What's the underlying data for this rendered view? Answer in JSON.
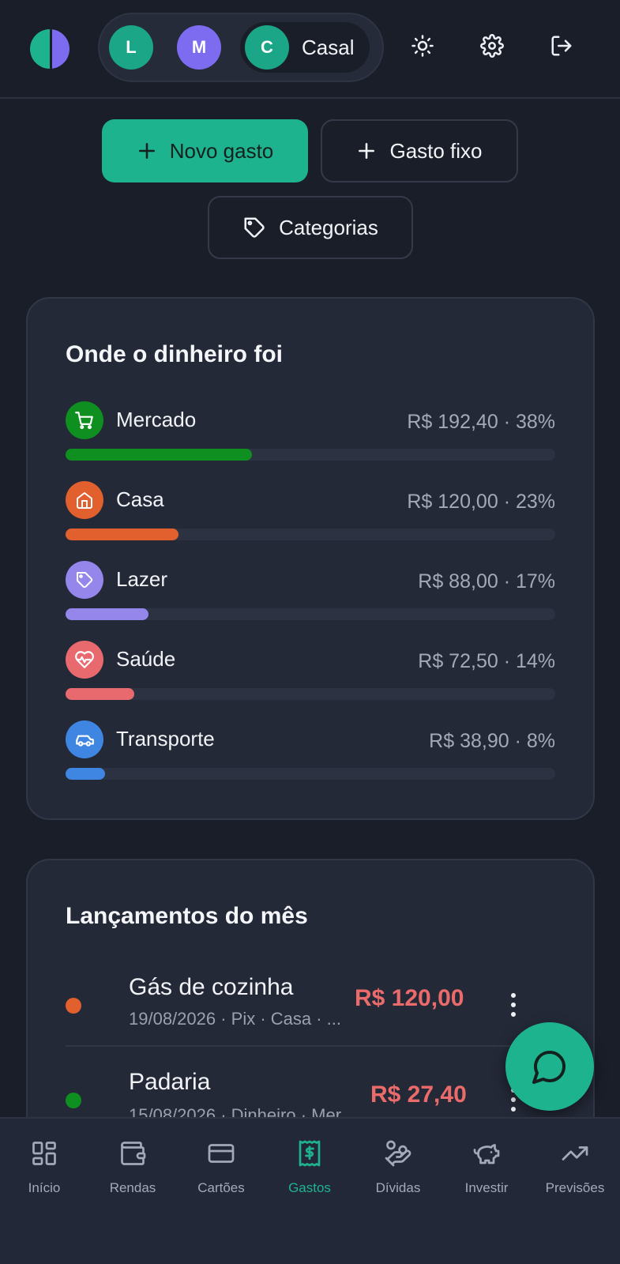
{
  "header": {
    "users": [
      {
        "initial": "L",
        "color": "#1aa687"
      },
      {
        "initial": "M",
        "color": "#7d6cf0"
      },
      {
        "initial": "C",
        "color": "#1aa687",
        "name": "Casal",
        "active": true
      }
    ],
    "icons": [
      "sun-icon",
      "gear-icon",
      "logout-icon"
    ]
  },
  "actions": {
    "new_expense": "Novo gasto",
    "fixed_expense": "Gasto fixo",
    "categories": "Categorias"
  },
  "spending": {
    "title": "Onde o dinheiro foi",
    "categories": [
      {
        "name": "Mercado",
        "value": "R$ 192,40 · 38%",
        "percent": 38,
        "color": "#0f8f1f",
        "icon": "cart-icon"
      },
      {
        "name": "Casa",
        "value": "R$ 120,00 · 23%",
        "percent": 23,
        "color": "#e2602e",
        "icon": "home-icon"
      },
      {
        "name": "Lazer",
        "value": "R$ 88,00 · 17%",
        "percent": 17,
        "color": "#9586ec",
        "icon": "tag-icon"
      },
      {
        "name": "Saúde",
        "value": "R$ 72,50 · 14%",
        "percent": 14,
        "color": "#e86a6f",
        "icon": "heart-pulse-icon"
      },
      {
        "name": "Transporte",
        "value": "R$ 38,90 · 8%",
        "percent": 8,
        "color": "#3f86e2",
        "icon": "car-icon"
      }
    ]
  },
  "transactions": {
    "title": "Lançamentos do mês",
    "items": [
      {
        "title": "Gás de cozinha",
        "subtitle": "19/08/2026 · Pix · Casa · ...",
        "amount": "R$ 120,00",
        "dot_color": "#e2602e"
      },
      {
        "title": "Padaria",
        "subtitle": "15/08/2026 · Dinheiro · Mer",
        "amount": "R$ 27,40",
        "dot_color": "#0f8f1f"
      }
    ]
  },
  "nav": [
    {
      "label": "Início",
      "icon": "grid-icon"
    },
    {
      "label": "Rendas",
      "icon": "wallet-icon"
    },
    {
      "label": "Cartões",
      "icon": "card-icon"
    },
    {
      "label": "Gastos",
      "icon": "receipt-icon",
      "active": true
    },
    {
      "label": "Dívidas",
      "icon": "hand-coins-icon"
    },
    {
      "label": "Investir",
      "icon": "piggy-bank-icon"
    },
    {
      "label": "Previsões",
      "icon": "trending-up-icon"
    }
  ]
}
